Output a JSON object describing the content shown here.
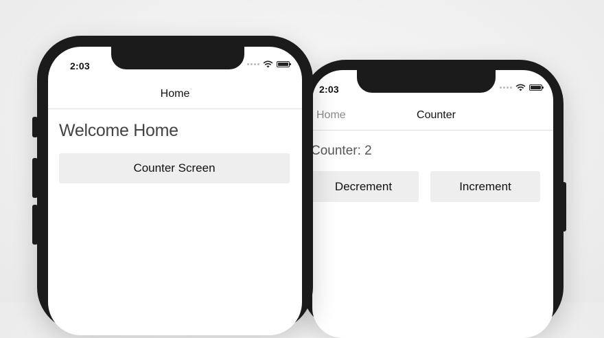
{
  "home_screen": {
    "status": {
      "time": "2:03"
    },
    "nav": {
      "title": "Home"
    },
    "heading": "Welcome Home",
    "button_label": "Counter Screen"
  },
  "counter_screen": {
    "status": {
      "time": "2:03"
    },
    "nav": {
      "back_label": "Home",
      "title": "Counter"
    },
    "counter_text": "Counter: 2",
    "decrement_label": "Decrement",
    "increment_label": "Increment"
  },
  "icons": {
    "signal": "cellular-signal-icon",
    "wifi": "wifi-icon",
    "battery": "battery-icon"
  },
  "colors": {
    "phone_frame": "#1b1b1b",
    "screen_bg": "#ffffff",
    "button_bg": "#eeeeee",
    "divider": "#dcdcdc",
    "back_label": "#8a8a8a"
  }
}
